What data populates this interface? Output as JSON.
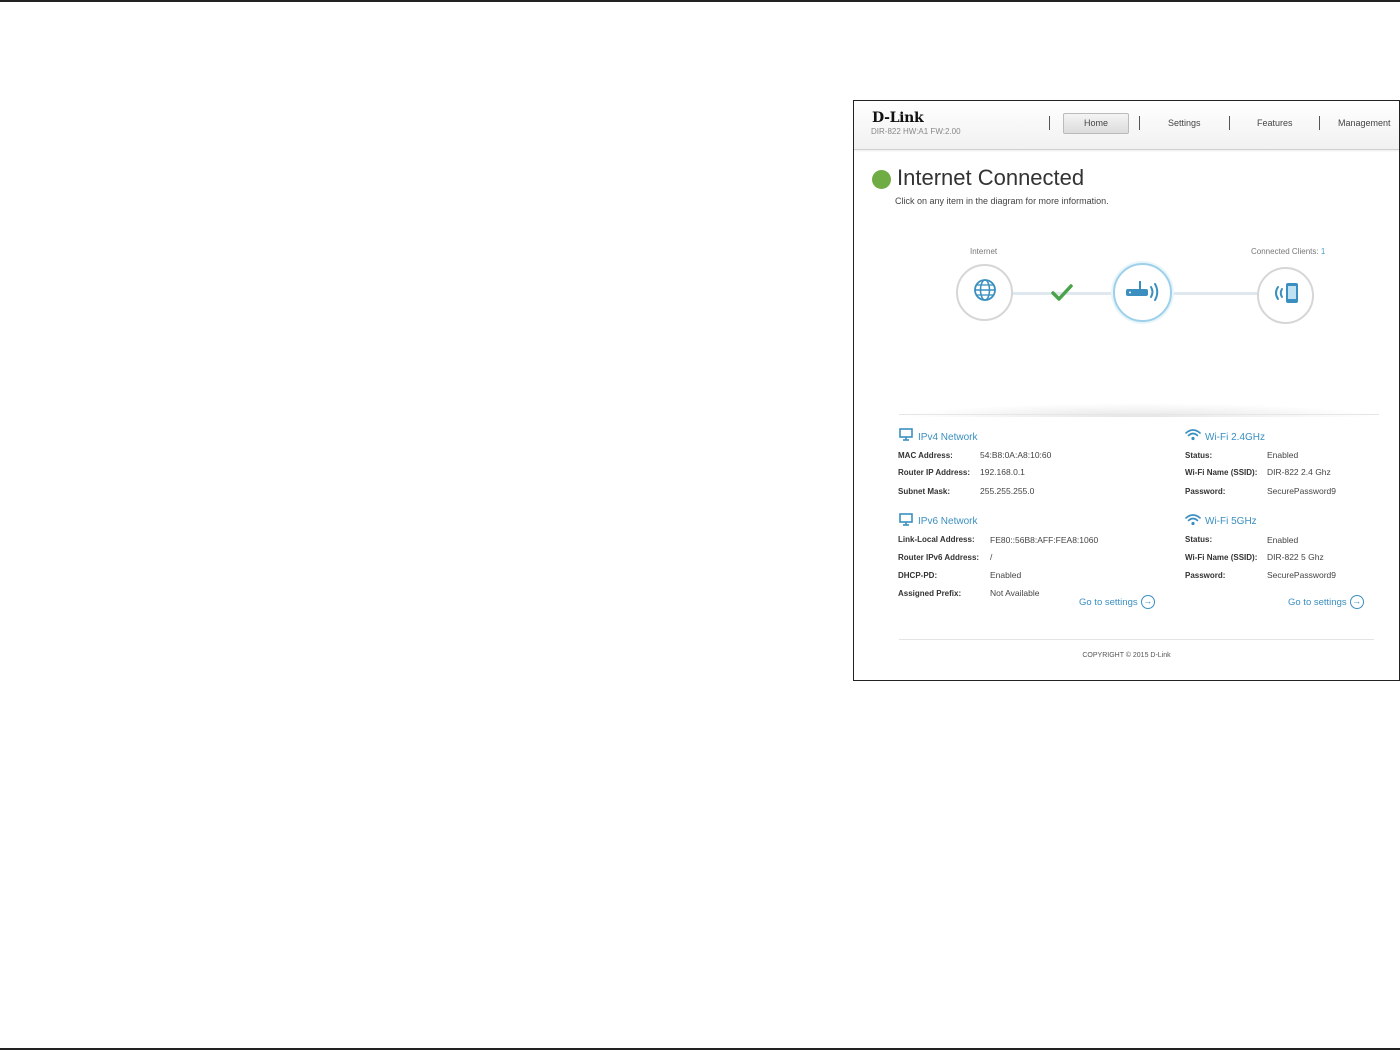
{
  "header": {
    "logo": "D-Link",
    "model": "DIR-822 HW:A1 FW:2.00",
    "nav": {
      "home": "Home",
      "settings": "Settings",
      "features": "Features",
      "management": "Management"
    }
  },
  "status": {
    "title": "Internet Connected",
    "subtitle": "Click on any item in the diagram for more information.",
    "color": "#6fad44"
  },
  "diagram": {
    "internet_label": "Internet",
    "clients_label": "Connected Clients:",
    "clients_count": "1",
    "nodes": [
      "globe-icon",
      "router-icon",
      "client-device-icon"
    ],
    "check_color": "#4aa34a"
  },
  "ipv4": {
    "title": "IPv4 Network",
    "mac_label": "MAC Address:",
    "mac_value": "54:B8:0A:A8:10:60",
    "router_ip_label": "Router IP Address:",
    "router_ip_value": "192.168.0.1",
    "subnet_label": "Subnet Mask:",
    "subnet_value": "255.255.255.0"
  },
  "ipv6": {
    "title": "IPv6 Network",
    "link_local_label": "Link-Local Address:",
    "link_local_value": "FE80::56B8:AFF:FEA8:1060",
    "router_ipv6_label": "Router IPv6 Address:",
    "router_ipv6_value": "/",
    "dhcp_pd_label": "DHCP-PD:",
    "dhcp_pd_value": "Enabled",
    "prefix_label": "Assigned Prefix:",
    "prefix_value": "Not Available",
    "goto": "Go to settings"
  },
  "wifi24": {
    "title": "Wi-Fi 2.4GHz",
    "status_label": "Status:",
    "status_value": "Enabled",
    "ssid_label": "Wi-Fi Name (SSID):",
    "ssid_value": "DIR-822 2.4 Ghz",
    "password_label": "Password:",
    "password_value": "SecurePassword9"
  },
  "wifi5": {
    "title": "Wi-Fi 5GHz",
    "status_label": "Status:",
    "status_value": "Enabled",
    "ssid_label": "Wi-Fi Name (SSID):",
    "ssid_value": "DIR-822 5 Ghz",
    "password_label": "Password:",
    "password_value": "SecurePassword9",
    "goto": "Go to settings"
  },
  "footer": {
    "copyright": "COPYRIGHT © 2015 D-Link"
  },
  "accent": "#3a8fc0"
}
